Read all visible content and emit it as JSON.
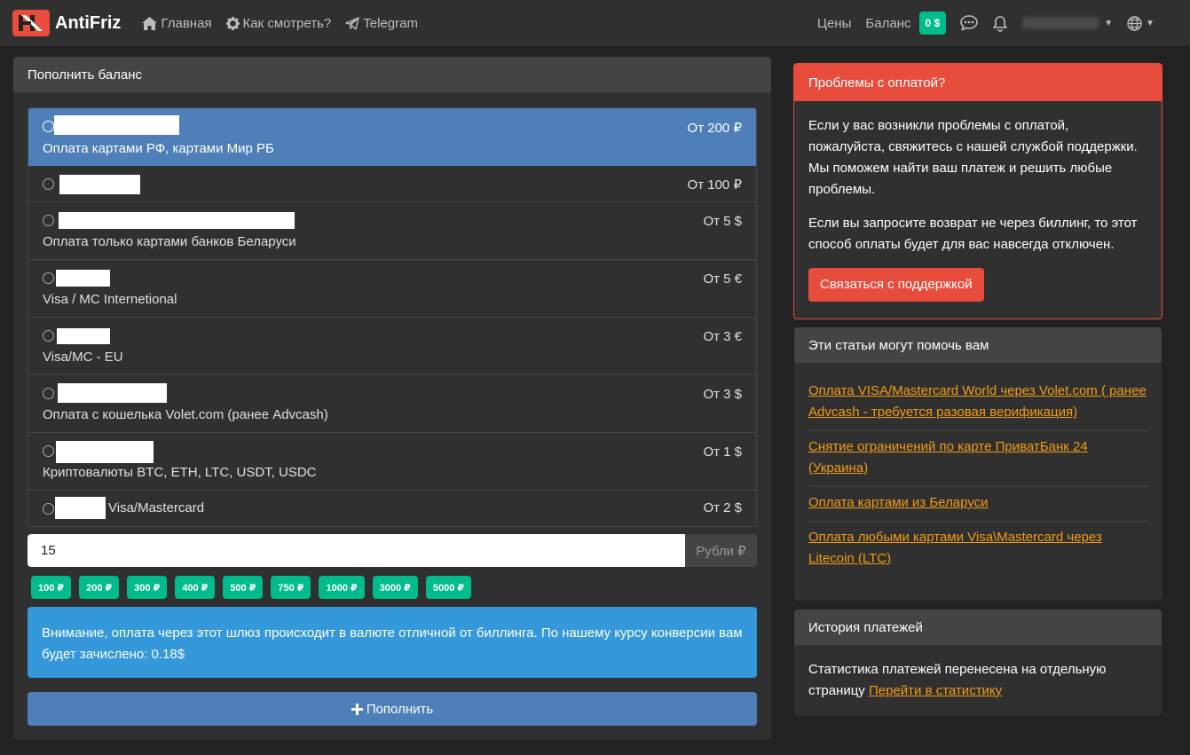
{
  "navbar": {
    "brand": "AntiFriz",
    "links": [
      {
        "label": "Главная",
        "icon": "home-icon"
      },
      {
        "label": "Как смотреть?",
        "icon": "gear-icon"
      },
      {
        "label": "Telegram",
        "icon": "telegram-icon"
      }
    ],
    "prices": "Цены",
    "balance_label": "Баланс",
    "balance_value": "0 $"
  },
  "topup": {
    "title": "Пополнить баланс",
    "methods": [
      {
        "description": "Оплата картами РФ, картами Мир РБ",
        "price": "От 200 ₽",
        "selected": true
      },
      {
        "description": "",
        "price": "От 100 ₽",
        "selected": false
      },
      {
        "description": "Оплата только картами банков Беларуси",
        "price": "От 5 $",
        "selected": false
      },
      {
        "description": "Visa / MC Internetional",
        "price": "От 5 €",
        "selected": false
      },
      {
        "description": "Visa/MC - EU",
        "price": "От 3 €",
        "selected": false
      },
      {
        "description": "Оплата с кошелька Volet.com (ранее Advcash)",
        "price": "От 3 $",
        "selected": false
      },
      {
        "description": "Криптовалюты BTC, ETH, LTC, USDT, USDC",
        "price": "От 1 $",
        "selected": false
      },
      {
        "description": "Visa/Mastercard",
        "price": "От 2 $",
        "selected": false
      }
    ],
    "amount_value": "15",
    "currency_addon": "Рубли ₽",
    "presets": [
      "100 ₽",
      "200 ₽",
      "300 ₽",
      "400 ₽",
      "500 ₽",
      "750 ₽",
      "1000 ₽",
      "3000 ₽",
      "5000 ₽"
    ],
    "notice": "Внимание, оплата через этот шлюз происходит в валюте отличной от биллинга. По нашему курсу конверсии вам будет зачислено: 0.18$",
    "submit_label": "Пополнить"
  },
  "problems": {
    "title": "Проблемы с оплатой?",
    "text1": "Если у вас возникли проблемы с оплатой, пожалуйста, свяжитесь с нашей службой поддержки. Мы поможем найти ваш платеж и решить любые проблемы.",
    "text2": "Если вы запросите возврат не через биллинг, то этот способ оплаты будет для вас навсегда отключен.",
    "button": "Связаться с поддержкой"
  },
  "articles": {
    "title": "Эти статьи могут помочь вам",
    "items": [
      "Оплата VISA/Mastercard World через Volet.com ( ранее Advcash - требуется разовая верификация)",
      "Снятие ограничений по карте ПриватБанк 24 (Украина)",
      "Оплата картами из Беларуси",
      "Оплата любыми картами Visa\\Mastercard через Litecoin (LTC)"
    ]
  },
  "history": {
    "title": "История платежей",
    "text": "Статистика платежей перенесена на отдельную страницу",
    "link": "Перейти в статистику"
  },
  "colors": {
    "background": "#222222",
    "card": "#303030",
    "header": "#444444",
    "primary": "#4e7fb8",
    "success": "#00bc8c",
    "danger": "#e74c3c",
    "info": "#3498db",
    "warning": "#f39c12"
  }
}
